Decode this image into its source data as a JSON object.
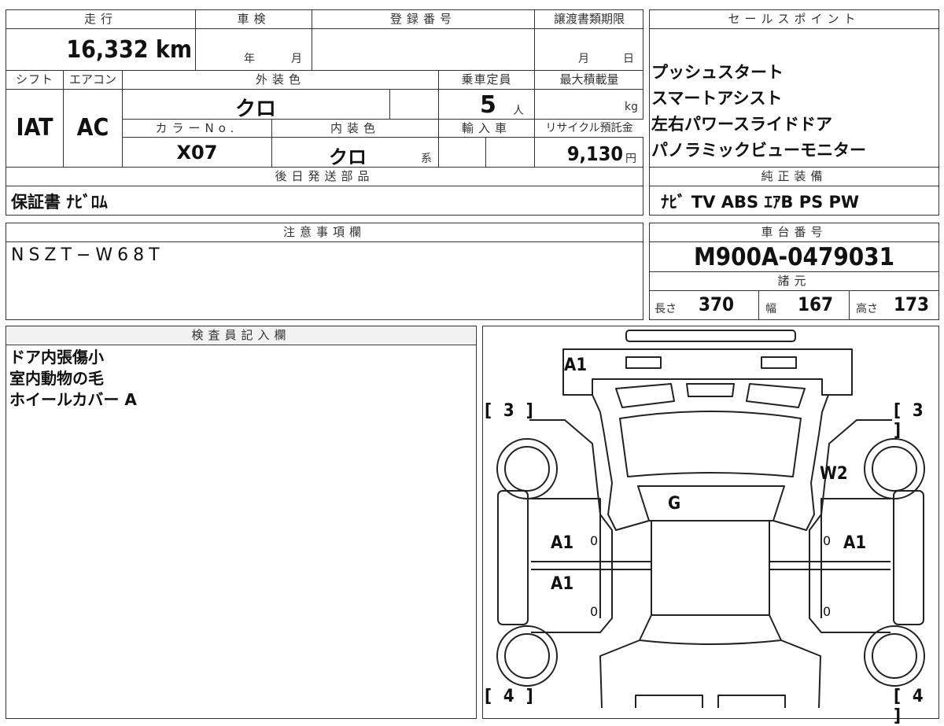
{
  "top": {
    "mileage_label": "走行",
    "mileage_value": "16,332",
    "mileage_unit": "km",
    "inspection_label": "車検",
    "inspection_year_unit": "年",
    "inspection_month_unit": "月",
    "registration_label": "登録番号",
    "transfer_label": "譲渡書類期限",
    "transfer_month_unit": "月",
    "transfer_day_unit": "日",
    "shift_label": "シフト",
    "shift_value": "IAT",
    "ac_label": "エアコン",
    "ac_value": "AC",
    "exterior_label": "外装色",
    "exterior_value": "クロ",
    "capacity_label": "乗車定員",
    "capacity_value": "5",
    "capacity_unit": "人",
    "load_label": "最大積載量",
    "load_unit": "kg",
    "color_no_label": "カラーNo.",
    "color_no_value": "X07",
    "interior_label": "内装色",
    "interior_value": "クロ",
    "interior_unit": "系",
    "import_label": "輸入車",
    "recycle_label": "リサイクル預託金",
    "recycle_value": "9,130",
    "recycle_unit": "円",
    "later_parts_label": "後日発送部品",
    "later_parts_value": "保証書 ﾅﾋﾞﾛﾑ"
  },
  "sales_points": {
    "label": "セールスポイント",
    "items": [
      "プッシュスタート",
      "スマートアシスト",
      "左右パワースライドドア",
      "パノラミックビューモニター"
    ]
  },
  "equipment": {
    "label": "純正装備",
    "value": "ﾅﾋﾞ TV ABS ｴｱB PS PW"
  },
  "notes": {
    "label": "注意事項欄",
    "value": "NSZT−W68T"
  },
  "chassis": {
    "label": "車台番号",
    "value": "M900A-0479031",
    "spec_label": "諸元",
    "length_label": "長さ",
    "length_value": "370",
    "width_label": "幅",
    "width_value": "167",
    "height_label": "高さ",
    "height_value": "173"
  },
  "inspector": {
    "label": "検査員記入欄",
    "lines": [
      "ドア内張傷小",
      "室内動物の毛",
      "ホイールカバー A"
    ]
  },
  "diagram": {
    "marks": {
      "rear_top": "A1",
      "left_top_bracket": "[ 3 ]",
      "right_top_bracket": "[ 3 ]",
      "right_quarter": "W2",
      "roof": "G",
      "left_door_1": "A1",
      "left_door_2": "A1",
      "right_door_1": "A1",
      "left_bottom_bracket": "[ 4 ]",
      "right_bottom_bracket": "[ 4 ]",
      "zero": "0"
    }
  }
}
